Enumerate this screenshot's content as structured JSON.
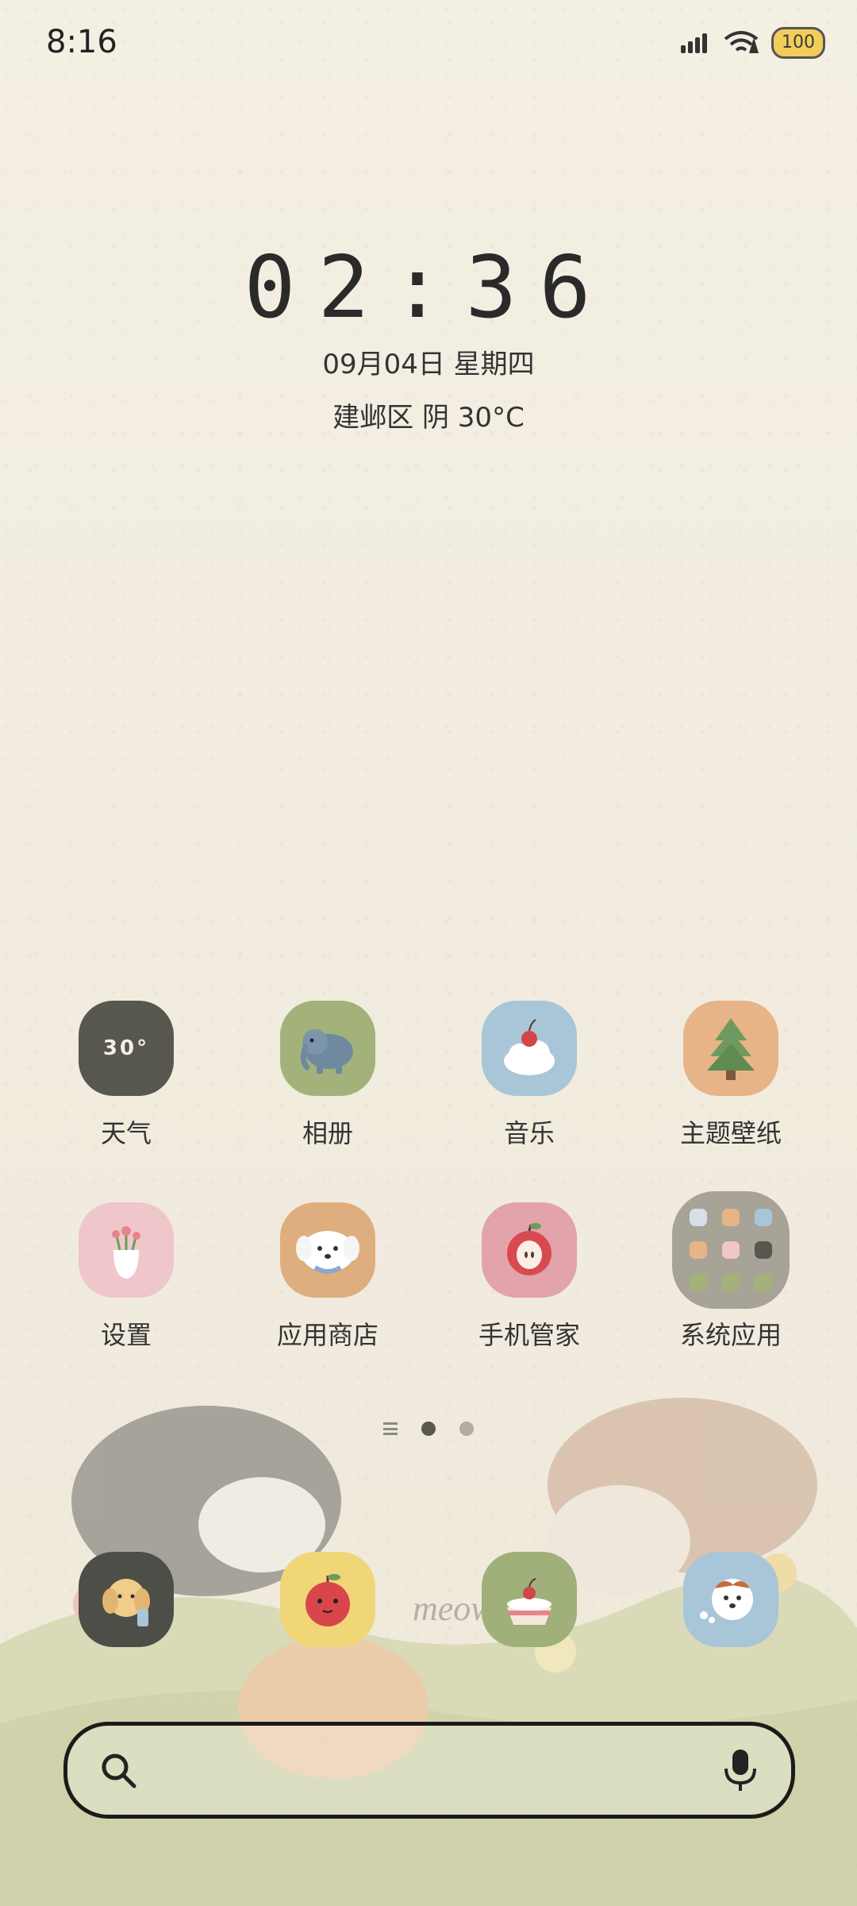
{
  "status_bar": {
    "time": "8:16",
    "battery": "100"
  },
  "clock": {
    "time": "02:36",
    "date": "09月04日 星期四",
    "weather": "建邺区 阴 30°C"
  },
  "apps": [
    {
      "label": "天气",
      "icon": "weather-icon",
      "icon_text": "30°"
    },
    {
      "label": "相册",
      "icon": "elephant-icon"
    },
    {
      "label": "音乐",
      "icon": "cherry-cream-icon"
    },
    {
      "label": "主题壁纸",
      "icon": "tree-icon"
    },
    {
      "label": "设置",
      "icon": "flower-vase-icon"
    },
    {
      "label": "应用商店",
      "icon": "puppy-icon"
    },
    {
      "label": "手机管家",
      "icon": "apple-icon"
    },
    {
      "label": "系统应用",
      "icon": "folder-icon"
    }
  ],
  "pages": {
    "count": 2,
    "active": 1
  },
  "dock": [
    {
      "icon": "dog-phone-icon"
    },
    {
      "icon": "apple-sticker-icon"
    },
    {
      "icon": "cake-icon"
    },
    {
      "icon": "corgi-icon"
    }
  ],
  "search": {
    "left_icon": "search-icon",
    "right_icon": "mic-icon"
  },
  "wallpaper_text": "meow"
}
